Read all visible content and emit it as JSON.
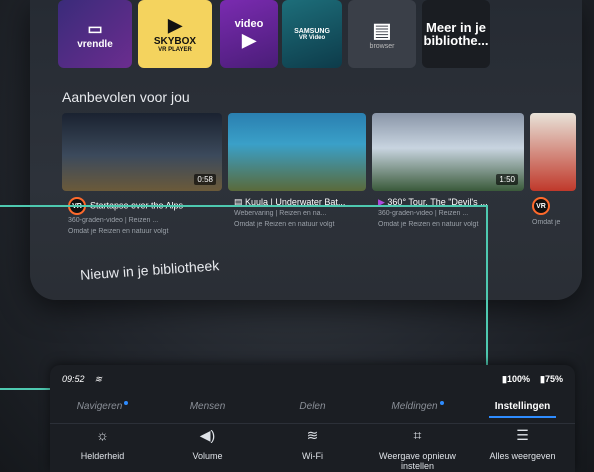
{
  "apps": [
    {
      "id": "vrendle",
      "label": "vrendle"
    },
    {
      "id": "skybox",
      "label": "SKYBOX",
      "sub": "VR PLAYER"
    },
    {
      "id": "video",
      "label": "video"
    },
    {
      "id": "samsung",
      "label": "SAMSUNG",
      "sub": "VR Video"
    },
    {
      "id": "browser",
      "label": "browser"
    },
    {
      "id": "more",
      "label": "Meer in je bibliothe..."
    }
  ],
  "recommended": {
    "title": "Aanbevolen voor jou",
    "cards": [
      {
        "title": "Startapse over the Alps",
        "sub": "360-graden-video | Reizen ...",
        "reason": "Omdat je Reizen en natuur volgt",
        "duration": "0:58",
        "badge": "VR"
      },
      {
        "title": "Kuula | Underwater Bat...",
        "sub": "Webervaring | Reizen en na...",
        "reason": "Omdat je Reizen en natuur volgt",
        "duration": "",
        "badge": ""
      },
      {
        "title": "360° Tour, The \"Devil's ...",
        "sub": "360-graden-video | Reizen ...",
        "reason": "Omdat je Reizen en natuur volgt",
        "duration": "1:50",
        "badge": ""
      },
      {
        "title": "",
        "sub": "",
        "reason": "Omdat je",
        "duration": "",
        "badge": "VR"
      }
    ]
  },
  "library": {
    "title": "Nieuw in je bibliotheek"
  },
  "status": {
    "time": "09:52",
    "battery_controller": "100%",
    "battery_headset": "75%"
  },
  "tabs": [
    {
      "label": "Navigeren",
      "dot": true,
      "active": false
    },
    {
      "label": "Mensen",
      "dot": false,
      "active": false
    },
    {
      "label": "Delen",
      "dot": false,
      "active": false
    },
    {
      "label": "Meldingen",
      "dot": true,
      "active": false
    },
    {
      "label": "Instellingen",
      "dot": false,
      "active": true
    }
  ],
  "quick": [
    {
      "label": "Helderheid",
      "icon": "brightness-icon"
    },
    {
      "label": "Volume",
      "icon": "volume-icon"
    },
    {
      "label": "Wi-Fi",
      "icon": "wifi-icon"
    },
    {
      "label": "Weergave opnieuw instellen",
      "icon": "recenter-icon"
    },
    {
      "label": "Alles weergeven",
      "icon": "settings-sliders-icon"
    }
  ],
  "colors": {
    "accent": "#2e8cff",
    "annotation": "#4ec9b0"
  }
}
